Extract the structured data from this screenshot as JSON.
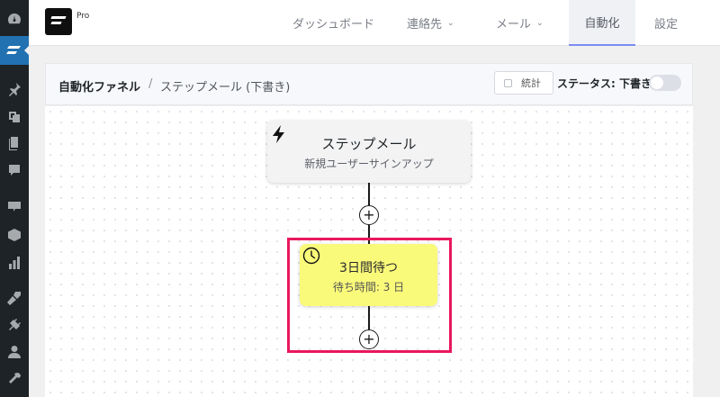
{
  "app": {
    "brand_suffix": "Pro"
  },
  "nav": {
    "items": [
      {
        "label": "ダッシュボード",
        "has_menu": false
      },
      {
        "label": "連絡先",
        "has_menu": true
      },
      {
        "label": "メール",
        "has_menu": true
      },
      {
        "label": "自動化",
        "has_menu": false,
        "active": true
      },
      {
        "label": "設定",
        "has_menu": false
      }
    ]
  },
  "breadcrumb": {
    "root": "自動化ファネル",
    "separator": "/",
    "current": "ステップメール (下書き)"
  },
  "toolbar": {
    "stats_label": "統計",
    "status_label": "ステータス: 下書き",
    "status_enabled": false
  },
  "funnel": {
    "trigger": {
      "title": "ステップメール",
      "subtitle": "新規ユーザーサインアップ"
    },
    "wait": {
      "title": "3日間待つ",
      "subtitle": "待ち時間: 3 日"
    },
    "add_step_symbol": "+"
  },
  "colors": {
    "wp_sidebar": "#1d2327",
    "wp_active": "#2271b1",
    "wait_node": "#fafa7a",
    "highlight": "#e8185e",
    "nav_active_underline": "#7b8cf0"
  }
}
